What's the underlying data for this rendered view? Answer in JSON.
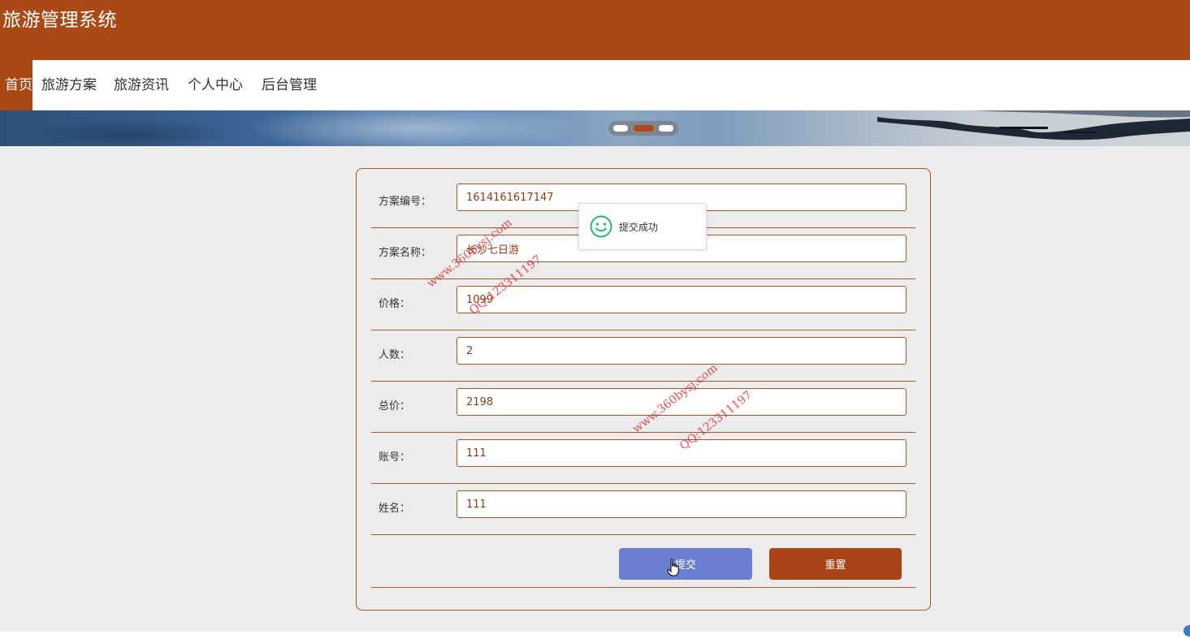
{
  "app": {
    "title": "旅游管理系统"
  },
  "nav": {
    "items": [
      {
        "label": "首页",
        "active": true
      },
      {
        "label": "旅游方案",
        "active": false
      },
      {
        "label": "旅游资讯",
        "active": false
      },
      {
        "label": "个人中心",
        "active": false
      },
      {
        "label": "后台管理",
        "active": false
      }
    ]
  },
  "carousel": {
    "slides": 3,
    "active_index": 1
  },
  "form": {
    "fields": [
      {
        "label": "方案编号：",
        "value": "1614161617147"
      },
      {
        "label": "方案名称：",
        "value": "长沙七日游"
      },
      {
        "label": "价格：",
        "value": "1099"
      },
      {
        "label": "人数：",
        "value": "2"
      },
      {
        "label": "总价：",
        "value": "2198"
      },
      {
        "label": "账号：",
        "value": "111"
      },
      {
        "label": "姓名：",
        "value": "111"
      }
    ],
    "submit_label": "提交",
    "reset_label": "重置"
  },
  "toast": {
    "icon": "smile-icon",
    "message": "提交成功"
  },
  "watermarks": [
    {
      "site": "www.360bysj.com",
      "qq": "QQ:123311197"
    },
    {
      "site": "www.360bysj.com",
      "qq": "QQ:123311197"
    }
  ],
  "colors": {
    "brand": "#a94a16",
    "submit_button": "#6a7fd1",
    "reset_button": "#a84416",
    "success_icon": "#2bb673",
    "watermark": "#e62828"
  }
}
